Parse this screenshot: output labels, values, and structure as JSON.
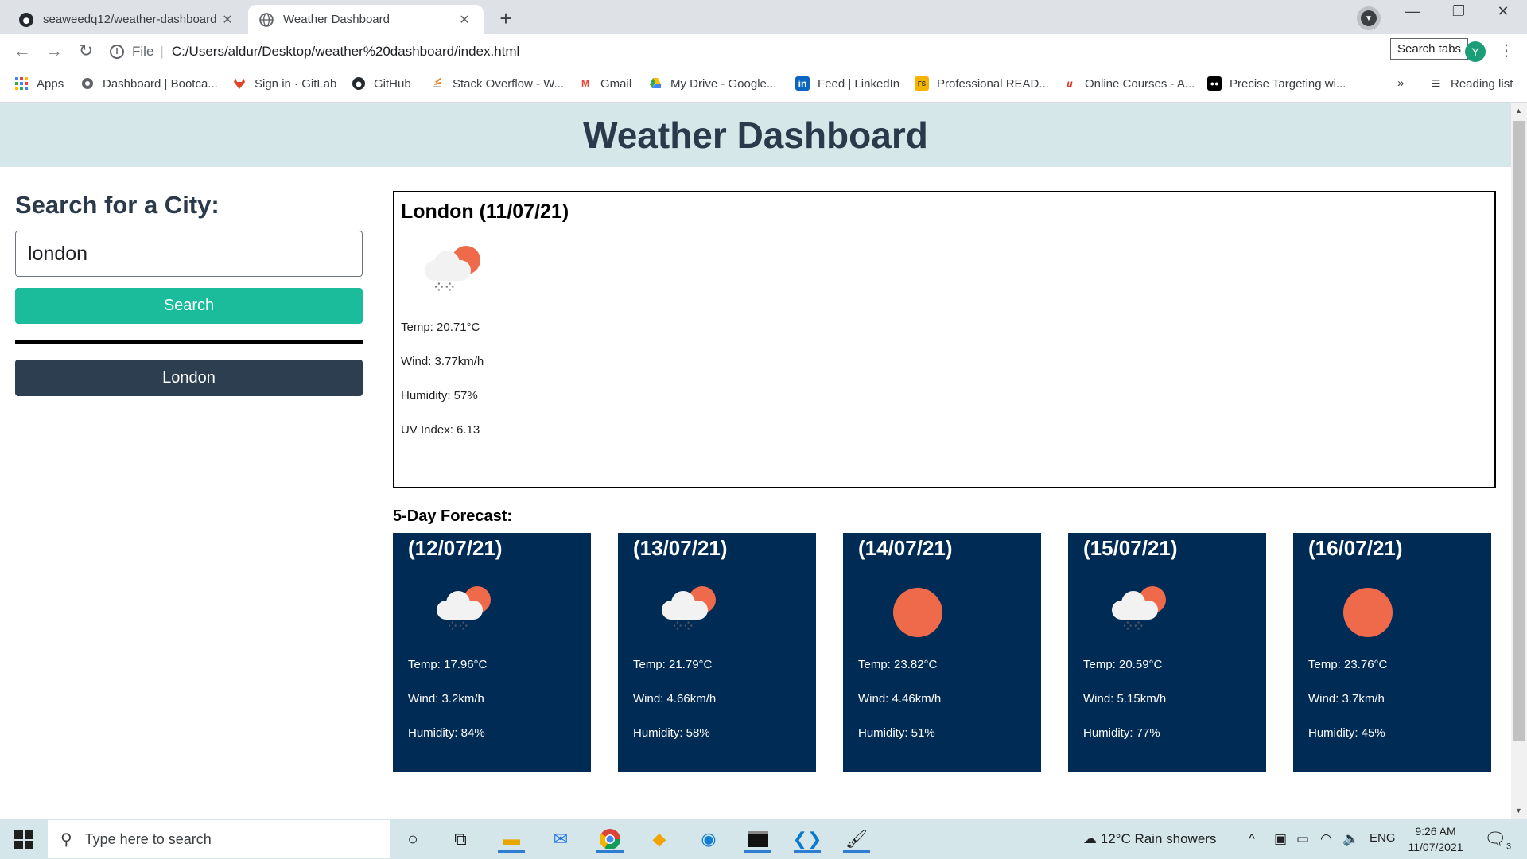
{
  "browser": {
    "tabs": [
      {
        "title": "seaweedq12/weather-dashboard",
        "icon": "github-icon",
        "close": "✕"
      },
      {
        "title": "Weather Dashboard",
        "icon": "globe-icon",
        "close": "✕"
      }
    ],
    "new_tab": "+",
    "address": {
      "scheme_label": "File",
      "url": "C:/Users/aldur/Desktop/weather%20dashboard/index.html"
    },
    "search_tabs_tooltip": "Search tabs",
    "profile_initial": "Y",
    "bookmarks": [
      {
        "label": "Apps",
        "icon": "apps-grid-icon"
      },
      {
        "label": "Dashboard | Bootca...",
        "icon": "bootcamp-icon"
      },
      {
        "label": "Sign in · GitLab",
        "icon": "gitlab-icon"
      },
      {
        "label": "GitHub",
        "icon": "github-icon"
      },
      {
        "label": "Stack Overflow - W...",
        "icon": "stackoverflow-icon"
      },
      {
        "label": "Gmail",
        "icon": "gmail-icon"
      },
      {
        "label": "My Drive - Google...",
        "icon": "google-drive-icon"
      },
      {
        "label": "Feed | LinkedIn",
        "icon": "linkedin-icon"
      },
      {
        "label": "Professional READ...",
        "icon": "fs-icon"
      },
      {
        "label": "Online Courses - A...",
        "icon": "udemy-icon"
      },
      {
        "label": "Precise Targeting wi...",
        "icon": "medium-icon"
      }
    ],
    "bookmarks_overflow": "»",
    "reading_list": "Reading list"
  },
  "page": {
    "title": "Weather Dashboard",
    "sidebar": {
      "heading": "Search for a City:",
      "input_value": "london",
      "search_label": "Search",
      "history": [
        "London"
      ]
    },
    "current": {
      "heading": "London (11/07/21)",
      "icon": "rain-cloud-sun-icon",
      "temp": "Temp: 20.71°C",
      "wind": "Wind: 3.77km/h",
      "humidity": "Humidity: 57%",
      "uv": "UV Index: 6.13"
    },
    "forecast_title": "5-Day Forecast:",
    "forecast": [
      {
        "date": "(12/07/21)",
        "icon": "rain-cloud-sun-icon",
        "temp": "Temp: 17.96°C",
        "wind": "Wind: 3.2km/h",
        "humidity": "Humidity: 84%"
      },
      {
        "date": "(13/07/21)",
        "icon": "rain-cloud-sun-icon",
        "temp": "Temp: 21.79°C",
        "wind": "Wind: 4.66km/h",
        "humidity": "Humidity: 58%"
      },
      {
        "date": "(14/07/21)",
        "icon": "sun-icon",
        "temp": "Temp: 23.82°C",
        "wind": "Wind: 4.46km/h",
        "humidity": "Humidity: 51%"
      },
      {
        "date": "(15/07/21)",
        "icon": "rain-cloud-sun-icon",
        "temp": "Temp: 20.59°C",
        "wind": "Wind: 5.15km/h",
        "humidity": "Humidity: 77%"
      },
      {
        "date": "(16/07/21)",
        "icon": "sun-icon",
        "temp": "Temp: 23.76°C",
        "wind": "Wind: 3.7km/h",
        "humidity": "Humidity: 45%"
      }
    ]
  },
  "taskbar": {
    "search_placeholder": "Type here to search",
    "weather": "12°C  Rain showers",
    "language": "ENG",
    "time": "9:26 AM",
    "date": "11/07/2021",
    "notification_count": "3"
  },
  "colors": {
    "header_bg": "#d6e7e9",
    "search_button": "#1abc9c",
    "history_button": "#2c3e50",
    "forecast_card": "#002b55",
    "sun": "#ef6a4a"
  }
}
